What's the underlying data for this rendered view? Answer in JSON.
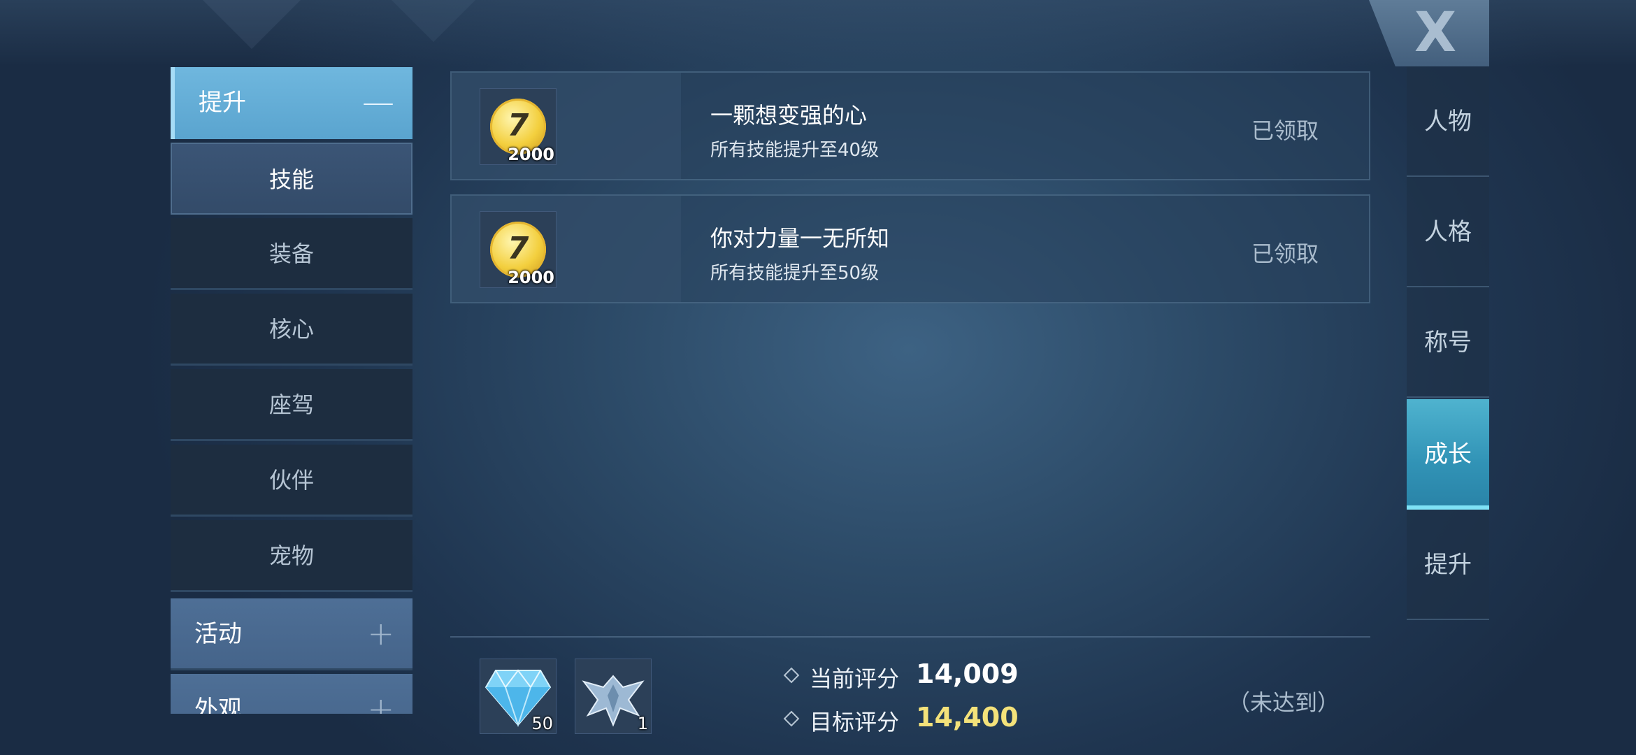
{
  "close": {
    "label": "X"
  },
  "left_menu": {
    "open_category": {
      "label": "提升",
      "sign": "—"
    },
    "subitems": [
      {
        "label": "技能",
        "active": true
      },
      {
        "label": "装备"
      },
      {
        "label": "核心"
      },
      {
        "label": "座驾"
      },
      {
        "label": "伙伴"
      },
      {
        "label": "宠物"
      }
    ],
    "closed_categories": [
      {
        "label": "活动",
        "sign": "+"
      },
      {
        "label": "外观",
        "sign": "+"
      }
    ]
  },
  "rewards": [
    {
      "icon": "gold-coin-icon",
      "count": "2000",
      "title": "一颗想变强的心",
      "desc": "所有技能提升至40级",
      "status": "已领取"
    },
    {
      "icon": "gold-coin-icon",
      "count": "2000",
      "title": "你对力量一无所知",
      "desc": "所有技能提升至50级",
      "status": "已领取"
    }
  ],
  "bottom": {
    "items": [
      {
        "icon": "diamond-icon",
        "count": "50"
      },
      {
        "icon": "wing-emblem-icon",
        "count": "1"
      }
    ],
    "current_score_label": "当前评分",
    "current_score": "14,009",
    "target_score_label": "目标评分",
    "target_score": "14,400",
    "status": "（未达到）"
  },
  "right_tabs": [
    {
      "label": "人物"
    },
    {
      "label": "人格"
    },
    {
      "label": "称号"
    },
    {
      "label": "成长",
      "active": true
    },
    {
      "label": "提升"
    }
  ],
  "colors": {
    "accent": "#5aa4cf",
    "active_tab": "#3193b6",
    "target_score": "#f4e27a"
  }
}
